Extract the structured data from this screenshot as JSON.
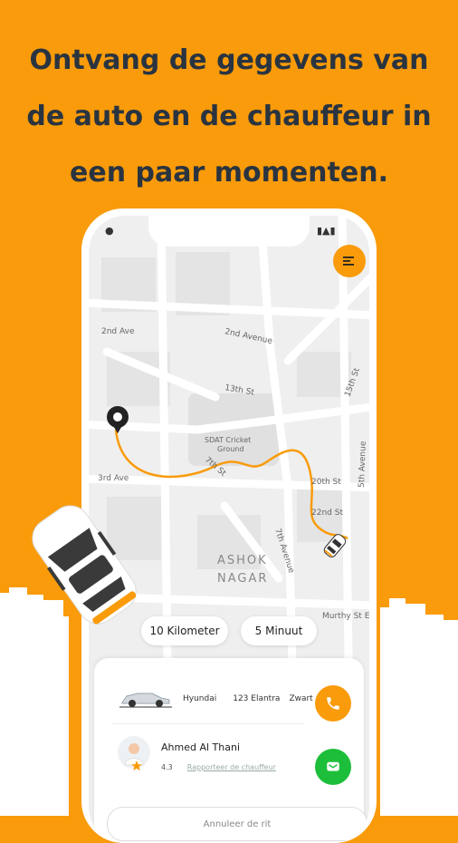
{
  "headline": {
    "line1": "Ontvang de gegevens van",
    "line2": "de auto en de chauffeur in",
    "line3": "een paar momenten."
  },
  "map": {
    "labels": {
      "second_ave": "2nd Ave",
      "second_avenue": "2nd Avenue",
      "thirteenth_st": "13th St",
      "fifteenth_st": "15th St",
      "third_ave": "3rd Ave",
      "seventh_st": "7th St",
      "twentieth_st": "20th St",
      "twentysecond_st": "22nd St",
      "fifth_avenue": "5th Avenue",
      "seventh_avenue": "7th Avenue",
      "murthy_st": "Murthy St E",
      "cricket_1": "SDAT Cricket",
      "cricket_2": "Ground",
      "district_1": "ASHOK",
      "district_2": "NAGAR",
      "second_ave_top": "2nd Ave"
    }
  },
  "trip": {
    "distance": "10 Kilometer",
    "eta": "5 Minuut"
  },
  "vehicle": {
    "make": "Hyundai",
    "model": "123 Elantra",
    "color": "Zwart"
  },
  "driver": {
    "name": "Ahmed Al Thani",
    "rating": "4.3",
    "report_link": "Rapporteer de chauffeur"
  },
  "actions": {
    "cancel": "Annuleer de rit"
  },
  "colors": {
    "accent": "#F99B0A",
    "message": "#1DBF3A",
    "text_dark": "#2A3440"
  },
  "icons": {
    "menu": "menu-icon",
    "call": "phone-icon",
    "message": "message-icon",
    "pickup": "location-pin-icon",
    "star": "star-icon"
  }
}
